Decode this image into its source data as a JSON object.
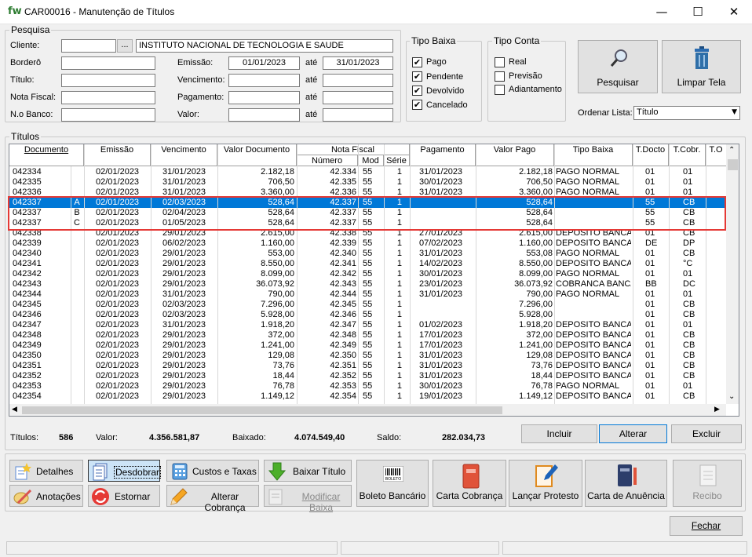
{
  "window": {
    "title": "CAR00016 - Manutenção de Títulos",
    "logo": "fw",
    "minimize": "—",
    "maximize": "☐",
    "close": "✕"
  },
  "pesquisa": {
    "legend": "Pesquisa",
    "cliente_label": "Cliente:",
    "cliente_value": "",
    "cliente_btn": "...",
    "cliente_nome": "INSTITUTO NACIONAL DE TECNOLOGIA E SAUDE",
    "bordero_label": "Borderô",
    "titulo_label": "Título:",
    "nota_label": "Nota Fiscal:",
    "banco_label": "N.o Banco:",
    "emissao_label": "Emissão:",
    "emissao_de": "01/01/2023",
    "emissao_ate": "31/01/2023",
    "ate": "até",
    "vencimento_label": "Vencimento:",
    "pagamento_label": "Pagamento:",
    "valor_label": "Valor:"
  },
  "tipo_baixa": {
    "legend": "Tipo Baixa",
    "items": [
      {
        "label": "Pago",
        "checked": "✔"
      },
      {
        "label": "Pendente",
        "checked": "✔"
      },
      {
        "label": "Devolvido",
        "checked": "✔"
      },
      {
        "label": "Cancelado",
        "checked": "✔"
      }
    ]
  },
  "tipo_conta": {
    "legend": "Tipo Conta",
    "items": [
      {
        "label": "Real",
        "checked": ""
      },
      {
        "label": "Previsão",
        "checked": ""
      },
      {
        "label": "Adiantamento",
        "checked": ""
      }
    ]
  },
  "actions": {
    "pesquisar": "Pesquisar",
    "limpar": "Limpar Tela",
    "ordenar_label": "Ordenar Lista:",
    "ordenar_value": "Título"
  },
  "titulos": {
    "legend": "Títulos",
    "headers": {
      "documento": "Documento",
      "emissao": "Emissão",
      "vencimento": "Vencimento",
      "valor_doc": "Valor Documento",
      "nota_fiscal": "Nota Fiscal",
      "numero": "Número",
      "mod": "Mod",
      "serie": "Série",
      "pagamento": "Pagamento",
      "valor_pago": "Valor Pago",
      "tipo_baixa": "Tipo Baixa",
      "t_docto": "T.Docto",
      "t_cobr": "T.Cobr.",
      "t_o": "T.O"
    },
    "rows": [
      [
        "042334",
        "",
        "02/01/2023",
        "31/01/2023",
        "2.182,18",
        "42.334",
        "55",
        "1",
        "31/01/2023",
        "2.182,18",
        "PAGO NORMAL",
        "01",
        "01"
      ],
      [
        "042335",
        "",
        "02/01/2023",
        "31/01/2023",
        "706,50",
        "42.335",
        "55",
        "1",
        "30/01/2023",
        "706,50",
        "PAGO NORMAL",
        "01",
        "01"
      ],
      [
        "042336",
        "",
        "02/01/2023",
        "31/01/2023",
        "3.360,00",
        "42.336",
        "55",
        "1",
        "31/01/2023",
        "3.360,00",
        "PAGO NORMAL",
        "01",
        "01"
      ],
      [
        "042337",
        "A",
        "02/01/2023",
        "02/03/2023",
        "528,64",
        "42.337",
        "55",
        "1",
        "",
        "528,64",
        "",
        "55",
        "CB"
      ],
      [
        "042337",
        "B",
        "02/01/2023",
        "02/04/2023",
        "528,64",
        "42.337",
        "55",
        "1",
        "",
        "528,64",
        "",
        "55",
        "CB"
      ],
      [
        "042337",
        "C",
        "02/01/2023",
        "01/05/2023",
        "528,64",
        "42.337",
        "55",
        "1",
        "",
        "528,64",
        "",
        "55",
        "CB"
      ],
      [
        "042338",
        "",
        "02/01/2023",
        "29/01/2023",
        "2.615,00",
        "42.338",
        "55",
        "1",
        "27/01/2023",
        "2.615,00",
        "DEPOSITO BANCA",
        "01",
        "CB"
      ],
      [
        "042339",
        "",
        "02/01/2023",
        "06/02/2023",
        "1.160,00",
        "42.339",
        "55",
        "1",
        "07/02/2023",
        "1.160,00",
        "DEPOSITO BANCA",
        "DE",
        "DP"
      ],
      [
        "042340",
        "",
        "02/01/2023",
        "29/01/2023",
        "553,00",
        "42.340",
        "55",
        "1",
        "31/01/2023",
        "553,08",
        "PAGO NORMAL",
        "01",
        "CB"
      ],
      [
        "042341",
        "",
        "02/01/2023",
        "29/01/2023",
        "8.550,00",
        "42.341",
        "55",
        "1",
        "14/02/2023",
        "8.550,00",
        "DEPOSITO BANCA",
        "01",
        "°C"
      ],
      [
        "042342",
        "",
        "02/01/2023",
        "29/01/2023",
        "8.099,00",
        "42.342",
        "55",
        "1",
        "30/01/2023",
        "8.099,00",
        "PAGO NORMAL",
        "01",
        "01"
      ],
      [
        "042343",
        "",
        "02/01/2023",
        "29/01/2023",
        "36.073,92",
        "42.343",
        "55",
        "1",
        "23/01/2023",
        "36.073,92",
        "COBRANCA BANCA",
        "BB",
        "DC"
      ],
      [
        "042344",
        "",
        "02/01/2023",
        "31/01/2023",
        "790,00",
        "42.344",
        "55",
        "1",
        "31/01/2023",
        "790,00",
        "PAGO NORMAL",
        "01",
        "01"
      ],
      [
        "042345",
        "",
        "02/01/2023",
        "02/03/2023",
        "7.296,00",
        "42.345",
        "55",
        "1",
        "",
        "7.296,00",
        "",
        "01",
        "CB"
      ],
      [
        "042346",
        "",
        "02/01/2023",
        "02/03/2023",
        "5.928,00",
        "42.346",
        "55",
        "1",
        "",
        "5.928,00",
        "",
        "01",
        "CB"
      ],
      [
        "042347",
        "",
        "02/01/2023",
        "31/01/2023",
        "1.918,20",
        "42.347",
        "55",
        "1",
        "01/02/2023",
        "1.918,20",
        "DEPOSITO BANCA",
        "01",
        "01"
      ],
      [
        "042348",
        "",
        "02/01/2023",
        "29/01/2023",
        "372,00",
        "42.348",
        "55",
        "1",
        "17/01/2023",
        "372,00",
        "DEPOSITO BANCA",
        "01",
        "CB"
      ],
      [
        "042349",
        "",
        "02/01/2023",
        "29/01/2023",
        "1.241,00",
        "42.349",
        "55",
        "1",
        "17/01/2023",
        "1.241,00",
        "DEPOSITO BANCA",
        "01",
        "CB"
      ],
      [
        "042350",
        "",
        "02/01/2023",
        "29/01/2023",
        "129,08",
        "42.350",
        "55",
        "1",
        "31/01/2023",
        "129,08",
        "DEPOSITO BANCA",
        "01",
        "CB"
      ],
      [
        "042351",
        "",
        "02/01/2023",
        "29/01/2023",
        "73,76",
        "42.351",
        "55",
        "1",
        "31/01/2023",
        "73,76",
        "DEPOSITO BANCA",
        "01",
        "CB"
      ],
      [
        "042352",
        "",
        "02/01/2023",
        "29/01/2023",
        "18,44",
        "42.352",
        "55",
        "1",
        "31/01/2023",
        "18,44",
        "DEPOSITO BANCA",
        "01",
        "CB"
      ],
      [
        "042353",
        "",
        "02/01/2023",
        "29/01/2023",
        "76,78",
        "42.353",
        "55",
        "1",
        "30/01/2023",
        "76,78",
        "PAGO NORMAL",
        "01",
        "01"
      ],
      [
        "042354",
        "",
        "02/01/2023",
        "29/01/2023",
        "1.149,12",
        "42.354",
        "55",
        "1",
        "19/01/2023",
        "1.149,12",
        "DEPOSITO BANCA",
        "01",
        "CB"
      ]
    ]
  },
  "totals": {
    "titulos_label": "Títulos:",
    "titulos": "586",
    "valor_label": "Valor:",
    "valor": "4.356.581,87",
    "baixado_label": "Baixado:",
    "baixado": "4.074.549,40",
    "saldo_label": "Saldo:",
    "saldo": "282.034,73"
  },
  "grid_buttons": {
    "incluir": "Incluir",
    "alterar": "Alterar",
    "excluir": "Excluir"
  },
  "toolbar": {
    "detalhes": "Detalhes",
    "desdobrar": "Desdobrar",
    "custos": "Custos e Taxas",
    "baixar": "Baixar Título",
    "anotacoes": "Anotações",
    "estornar": "Estornar",
    "alterar_cobranca": "Alterar Cobrança",
    "modificar_baixa": "Modificar Baixa",
    "boleto": "Boleto Bancário",
    "boleto_icon_text": "BOLETO",
    "carta_cobranca": "Carta Cobrança",
    "lancar_protesto": "Lançar Protesto",
    "carta_anuencia": "Carta de Anuência",
    "recibo": "Recibo",
    "fechar": "Fechar"
  },
  "colors": {
    "selection": "#0078d7",
    "highlight_border": "#e53935",
    "accent_green": "#2e7d32"
  }
}
